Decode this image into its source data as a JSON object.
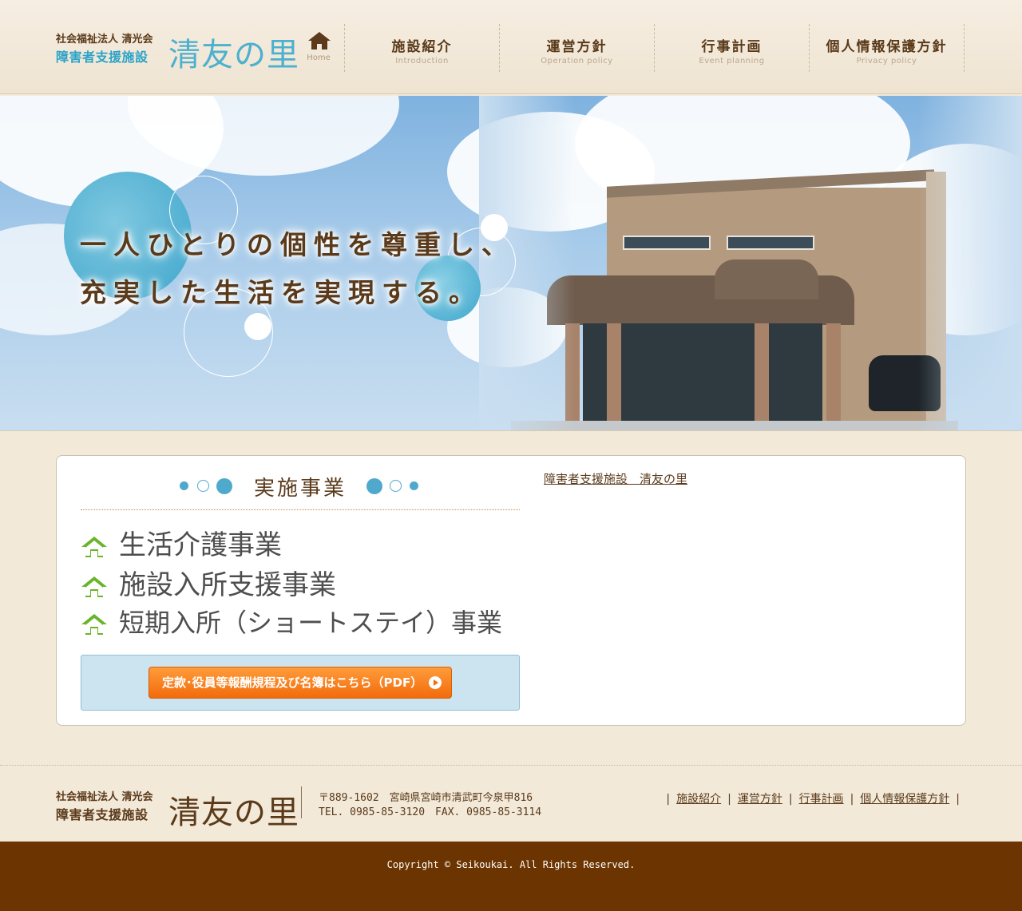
{
  "header": {
    "logo": {
      "org": "社会福祉法人 清光会",
      "type": "障害者支援施設",
      "name": "清友の里"
    },
    "nav": {
      "home": {
        "icon": "home-icon",
        "en": "Home"
      },
      "items": [
        {
          "jp": "施設紹介",
          "en": "Introduction"
        },
        {
          "jp": "運営方針",
          "en": "Operation policy"
        },
        {
          "jp": "行事計画",
          "en": "Event planning"
        },
        {
          "jp": "個人情報保護方針",
          "en": "Privacy policy"
        }
      ]
    }
  },
  "hero": {
    "line1": "一人ひとりの個性を尊重し、",
    "line2": "充実した生活を実現する。"
  },
  "main": {
    "section_title": "実施事業",
    "services": [
      "生活介護事業",
      "施設入所支援事業",
      "短期入所（ショートステイ）事業"
    ],
    "pdf_button": "定款･役員等報酬規程及び名簿はこちら（PDF）",
    "side_link": "障害者支援施設　清友の里"
  },
  "footer": {
    "logo": {
      "org": "社会福祉法人 清光会",
      "type": "障害者支援施設",
      "name": "清友の里"
    },
    "address": "〒889-1602　宮崎県宮崎市清武町今泉甲816",
    "tel_fax": "TEL. 0985-85-3120　FAX. 0985-85-3114",
    "links": [
      "施設紹介",
      "運営方針",
      "行事計画",
      "個人情報保護方針"
    ],
    "copyright": "Copyright © Seikoukai. All Rights Reserved."
  },
  "colors": {
    "brand_blue": "#4cb0cf",
    "brown": "#5a3a1a",
    "footer_bg": "#6b3400",
    "button_orange": "#f26b0c",
    "icon_green": "#6ab42a"
  }
}
